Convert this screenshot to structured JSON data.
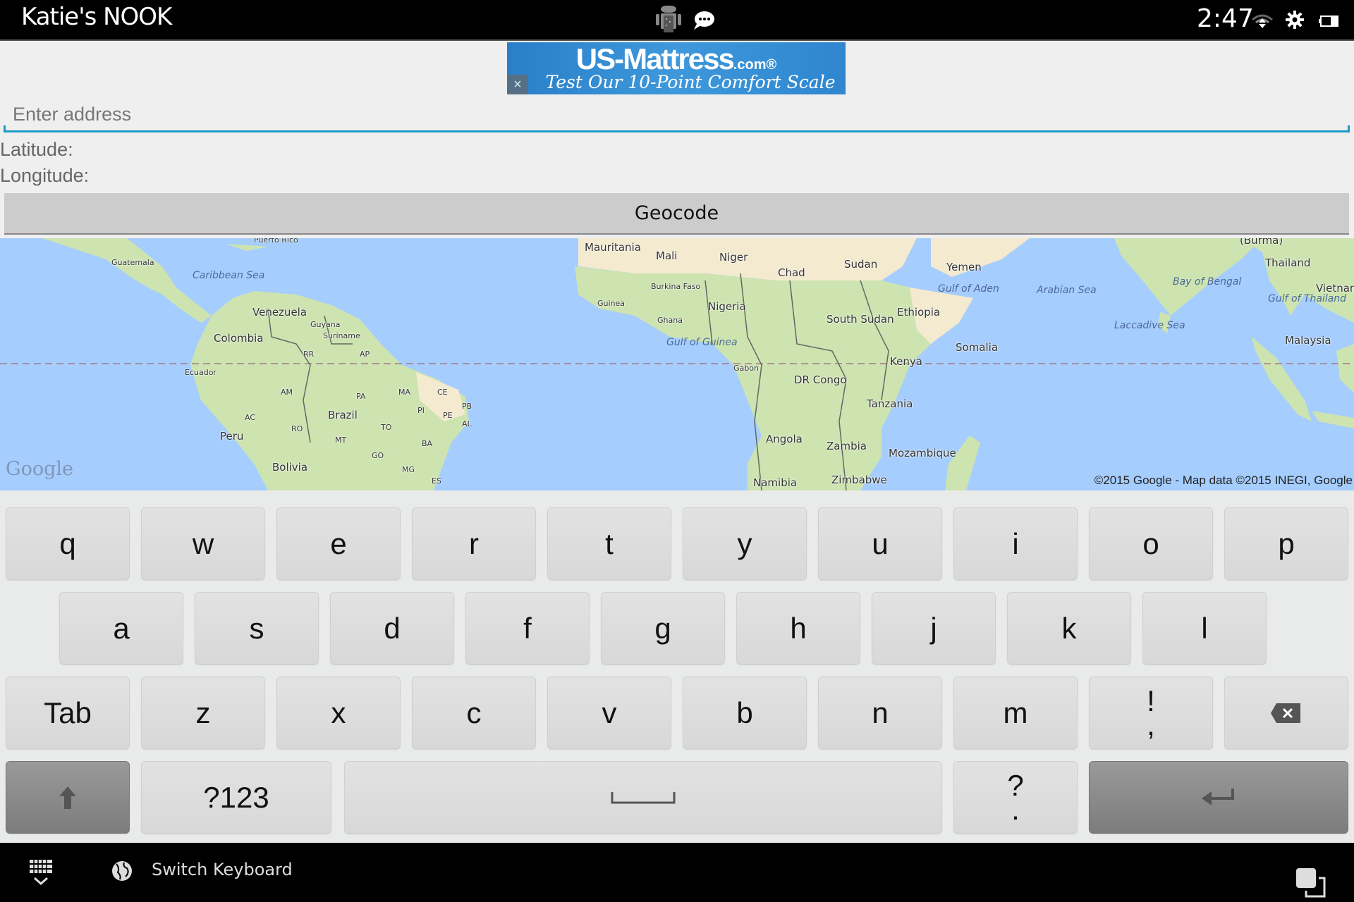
{
  "status_bar": {
    "device_name": "Katie's NOOK",
    "time": "2:47",
    "icons": [
      "android-debug-icon",
      "chat-notification-icon",
      "wifi-icon",
      "settings-gear-icon",
      "battery-icon"
    ]
  },
  "ad": {
    "brand": "US-Mattress",
    "brand_suffix": ".com®",
    "tagline": "Test Our 10-Point Comfort Scale",
    "close_label": "×"
  },
  "form": {
    "address_placeholder": "Enter address",
    "address_value": "",
    "latitude_label": "Latitude:",
    "longitude_label": "Longitude:",
    "geocode_label": "Geocode"
  },
  "map": {
    "logo": "Google",
    "copyright": "©2015 Google - Map data ©2015 INEGI, Google",
    "colors": {
      "water": "#a5cdfd",
      "land": "#cde4b0",
      "desert": "#f3ead0",
      "equator": "#a47a8a"
    },
    "labels": [
      {
        "text": "Puerto Rico",
        "kind": "sm"
      },
      {
        "text": "Guatemala",
        "kind": "sm"
      },
      {
        "text": "Caribbean Sea",
        "kind": "sea"
      },
      {
        "text": "Venezuela",
        "kind": "country"
      },
      {
        "text": "Guyana",
        "kind": "sm"
      },
      {
        "text": "Suriname",
        "kind": "sm"
      },
      {
        "text": "Colombia",
        "kind": "country"
      },
      {
        "text": "RR",
        "kind": "sm"
      },
      {
        "text": "AP",
        "kind": "sm"
      },
      {
        "text": "Ecuador",
        "kind": "sm"
      },
      {
        "text": "AM",
        "kind": "sm"
      },
      {
        "text": "PA",
        "kind": "sm"
      },
      {
        "text": "MA",
        "kind": "sm"
      },
      {
        "text": "CE",
        "kind": "sm"
      },
      {
        "text": "PB",
        "kind": "sm"
      },
      {
        "text": "PI",
        "kind": "sm"
      },
      {
        "text": "PE",
        "kind": "sm"
      },
      {
        "text": "AL",
        "kind": "sm"
      },
      {
        "text": "Brazil",
        "kind": "country"
      },
      {
        "text": "AC",
        "kind": "sm"
      },
      {
        "text": "RO",
        "kind": "sm"
      },
      {
        "text": "TO",
        "kind": "sm"
      },
      {
        "text": "MT",
        "kind": "sm"
      },
      {
        "text": "BA",
        "kind": "sm"
      },
      {
        "text": "Peru",
        "kind": "country"
      },
      {
        "text": "GO",
        "kind": "sm"
      },
      {
        "text": "Bolivia",
        "kind": "country"
      },
      {
        "text": "MG",
        "kind": "sm"
      },
      {
        "text": "ES",
        "kind": "sm"
      },
      {
        "text": "Mauritania",
        "kind": "country"
      },
      {
        "text": "Mali",
        "kind": "country"
      },
      {
        "text": "Niger",
        "kind": "country"
      },
      {
        "text": "Chad",
        "kind": "country"
      },
      {
        "text": "Sudan",
        "kind": "country"
      },
      {
        "text": "Yemen",
        "kind": "country"
      },
      {
        "text": "Gulf of Aden",
        "kind": "sea"
      },
      {
        "text": "Burkina Faso",
        "kind": "sm"
      },
      {
        "text": "Guinea",
        "kind": "sm"
      },
      {
        "text": "Nigeria",
        "kind": "country"
      },
      {
        "text": "Ethiopia",
        "kind": "country"
      },
      {
        "text": "Ghana",
        "kind": "sm"
      },
      {
        "text": "South Sudan",
        "kind": "country"
      },
      {
        "text": "Gulf of Guinea",
        "kind": "sea"
      },
      {
        "text": "Somalia",
        "kind": "country"
      },
      {
        "text": "Kenya",
        "kind": "country"
      },
      {
        "text": "Gabon",
        "kind": "sm"
      },
      {
        "text": "DR Congo",
        "kind": "country"
      },
      {
        "text": "Tanzania",
        "kind": "country"
      },
      {
        "text": "Angola",
        "kind": "country"
      },
      {
        "text": "Zambia",
        "kind": "country"
      },
      {
        "text": "Mozambique",
        "kind": "country"
      },
      {
        "text": "Namibia",
        "kind": "country"
      },
      {
        "text": "Zimbabwe",
        "kind": "country"
      },
      {
        "text": "Arabian Sea",
        "kind": "sea"
      },
      {
        "text": "Bay of Bengal",
        "kind": "sea"
      },
      {
        "text": "Laccadive Sea",
        "kind": "sea"
      },
      {
        "text": "(Burma)",
        "kind": "country"
      },
      {
        "text": "Thailand",
        "kind": "country"
      },
      {
        "text": "Vietnam",
        "kind": "country"
      },
      {
        "text": "Gulf of Thailand",
        "kind": "sea"
      },
      {
        "text": "Malaysia",
        "kind": "country"
      }
    ]
  },
  "keyboard": {
    "row1": [
      "q",
      "w",
      "e",
      "r",
      "t",
      "y",
      "u",
      "i",
      "o",
      "p"
    ],
    "row2": [
      "a",
      "s",
      "d",
      "f",
      "g",
      "h",
      "j",
      "k",
      "l"
    ],
    "row3": [
      "Tab",
      "z",
      "x",
      "c",
      "v",
      "b",
      "n",
      "m"
    ],
    "row3_punct": {
      "top": "!",
      "bottom": ","
    },
    "row4": {
      "symbols_label": "?123",
      "punct_top": "?",
      "punct_bottom": "."
    },
    "icons": [
      "shift-icon",
      "backspace-icon",
      "space-icon",
      "enter-icon"
    ]
  },
  "nav_bar": {
    "switch_keyboard_label": "Switch Keyboard",
    "icons": [
      "hide-keyboard-icon",
      "globe-icon",
      "recent-apps-icon"
    ]
  }
}
